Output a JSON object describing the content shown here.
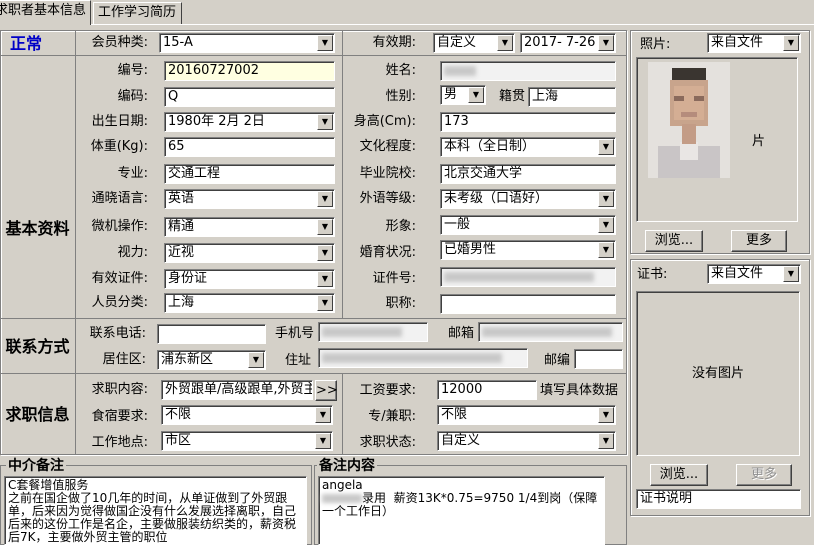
{
  "tabs": [
    "求职者基本信息",
    "工作学习简历"
  ],
  "status": {
    "label": "正常",
    "color": "#0000c8"
  },
  "sections": {
    "basic": "基本资料",
    "contact": "联系方式",
    "job": "求职信息"
  },
  "top": {
    "member_type": {
      "label": "会员种类:",
      "value": "15-A"
    },
    "validity": {
      "label": "有效期:",
      "value": "自定义"
    },
    "date": {
      "value": "2017- 7-26"
    }
  },
  "fields": {
    "code": {
      "label": "编号:",
      "value": "20160727002"
    },
    "name": {
      "label": "姓名:",
      "value": ""
    },
    "encode": {
      "label": "编码:",
      "value": "Q"
    },
    "gender": {
      "label": "性别:",
      "value": "男"
    },
    "origin": {
      "label": "籍贯",
      "value": "上海"
    },
    "birth": {
      "label": "出生日期:",
      "value": "1980年 2月 2日"
    },
    "height": {
      "label": "身高(Cm):",
      "value": "173"
    },
    "weight": {
      "label": "体重(Kg):",
      "value": "65"
    },
    "education": {
      "label": "文化程度:",
      "value": "本科（全日制）"
    },
    "major": {
      "label": "专业:",
      "value": "交通工程"
    },
    "school": {
      "label": "毕业院校:",
      "value": "北京交通大学"
    },
    "language": {
      "label": "通晓语言:",
      "value": "英语"
    },
    "lang_level": {
      "label": "外语等级:",
      "value": "未考级（口语好）"
    },
    "computer": {
      "label": "微机操作:",
      "value": "精通"
    },
    "appearance": {
      "label": "形象:",
      "value": "一般"
    },
    "vision": {
      "label": "视力:",
      "value": "近视"
    },
    "marital": {
      "label": "婚育状况:",
      "value": "已婚男性"
    },
    "id_type": {
      "label": "有效证件:",
      "value": "身份证"
    },
    "id_no": {
      "label": "证件号:",
      "value": ""
    },
    "category": {
      "label": "人员分类:",
      "value": "上海"
    },
    "title": {
      "label": "职称:",
      "value": ""
    }
  },
  "contact": {
    "phone": {
      "label": "联系电话:",
      "value": ""
    },
    "mobile": {
      "label": "手机号",
      "value": ""
    },
    "email": {
      "label": "邮箱",
      "value": ""
    },
    "district": {
      "label": "居住区:",
      "value": "浦东新区"
    },
    "address": {
      "label": "住址",
      "value": ""
    },
    "postcode": {
      "label": "邮编",
      "value": ""
    }
  },
  "job": {
    "content": {
      "label": "求职内容:",
      "value": "外贸跟单/高级跟单,外贸主",
      "btn": ">>"
    },
    "salary": {
      "label": "工资要求:",
      "value": "12000",
      "hint": "填写具体数据"
    },
    "board": {
      "label": "食宿要求:",
      "value": "不限"
    },
    "fulltime": {
      "label": "专/兼职:",
      "value": "不限"
    },
    "location": {
      "label": "工作地点:",
      "value": "市区"
    },
    "state": {
      "label": "求职状态:",
      "value": "自定义"
    }
  },
  "notes": {
    "agency": {
      "heading": "中介备注",
      "text": "C套餐增值服务\n之前在国企做了10几年的时间，从单证做到了外贸跟单，后来因为觉得做国企没有什么发展选择离职，自己后来的这份工作是名企，主要做服装纺织类的，薪资税后7K，主要做外贸主管的职位"
    },
    "remark": {
      "heading": "备注内容",
      "line1": "angela",
      "line2": "录用  薪资13K*0.75=9750 1/4到岗（保障一个工作日）"
    }
  },
  "photo": {
    "label": "照片:",
    "source": "来自文件",
    "overlay": "片",
    "browse": "浏览...",
    "more": "更多"
  },
  "certificate": {
    "label": "证书:",
    "source": "来自文件",
    "empty": "没有图片",
    "browse": "浏览...",
    "more": "更多",
    "desc": "证书说明"
  },
  "icons": {
    "dropdown": "dropdown-arrow-icon"
  }
}
